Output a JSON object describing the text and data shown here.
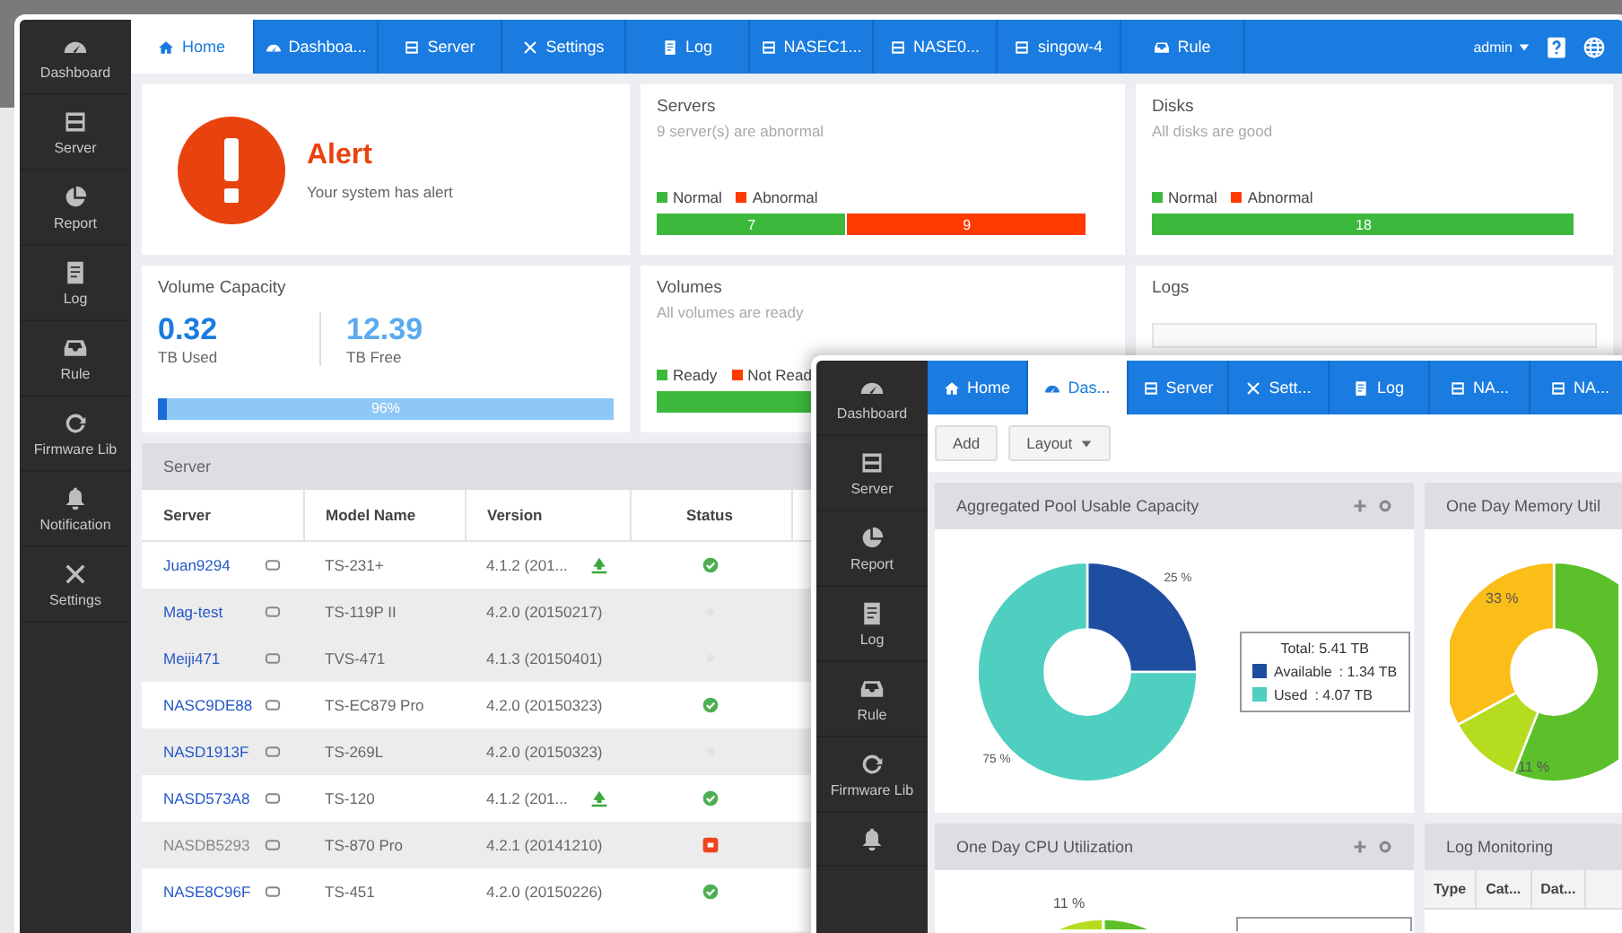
{
  "back_window": {
    "sidebar": [
      {
        "label": "Dashboard"
      },
      {
        "label": "Server"
      },
      {
        "label": "Report"
      },
      {
        "label": "Log"
      },
      {
        "label": "Rule"
      },
      {
        "label": "Firmware Lib"
      },
      {
        "label": "Notification"
      },
      {
        "label": "Settings"
      }
    ],
    "tabs": [
      {
        "label": "Home",
        "selected": true
      },
      {
        "label": "Dashboa...",
        "selected": false
      },
      {
        "label": "Server",
        "selected": false
      },
      {
        "label": "Settings",
        "selected": false
      },
      {
        "label": "Log",
        "selected": false
      },
      {
        "label": "NASEC1...",
        "selected": false
      },
      {
        "label": "NASE0...",
        "selected": false
      },
      {
        "label": "singow-4",
        "selected": false
      },
      {
        "label": "Rule",
        "selected": false
      }
    ],
    "user_menu": {
      "label": "admin"
    },
    "alert": {
      "title": "Alert",
      "message": "Your system has alert"
    },
    "servers": {
      "title": "Servers",
      "subtitle": "9 server(s) are abnormal",
      "legend": [
        {
          "label": "Normal",
          "color": "#3cb93c"
        },
        {
          "label": "Abnormal",
          "color": "#ff3b00"
        }
      ],
      "bar": [
        {
          "label": "7",
          "color": "#3cb93c",
          "level": 0.44
        },
        {
          "label": "9",
          "color": "#ff3b00",
          "level": 0.56
        }
      ]
    },
    "disks": {
      "title": "Disks",
      "subtitle": "All disks are good",
      "legend": [
        {
          "label": "Normal",
          "color": "#3cb93c"
        },
        {
          "label": "Abnormal",
          "color": "#ff3b00"
        }
      ],
      "bar": [
        {
          "label": "18",
          "color": "#3cb93c",
          "level": 1
        }
      ]
    },
    "volume_capacity": {
      "title": "Volume Capacity",
      "used": {
        "value": "0.32",
        "unit": "TB Used"
      },
      "free": {
        "value": "12.39",
        "unit": "TB Free"
      },
      "bar_label": "96%",
      "level": 0.02
    },
    "volumes": {
      "title": "Volumes",
      "subtitle": "All volumes are ready",
      "legend": [
        {
          "label": "Ready",
          "color": "#3cb93c"
        },
        {
          "label": "Not Read",
          "color": "#ff3b00"
        }
      ],
      "bar": [
        {
          "color": "#3cb93c",
          "level": 1
        }
      ]
    },
    "logs": {
      "title": "Logs"
    },
    "server_table": {
      "title": "Server",
      "columns": [
        "Server",
        "Model Name",
        "Version",
        "Status"
      ],
      "rows": [
        {
          "name": "Juan9294",
          "model": "TS-231+",
          "version": "4.1.2 (201...",
          "update": true,
          "kind": "ok",
          "offline": false,
          "disabled": false
        },
        {
          "name": "Mag-test",
          "model": "TS-119P II",
          "version": "4.2.0 (20150217)",
          "update": false,
          "kind": "none",
          "offline": true,
          "disabled": false
        },
        {
          "name": "Meiji471",
          "model": "TVS-471",
          "version": "4.1.3 (20150401)",
          "update": false,
          "kind": "none",
          "offline": true,
          "disabled": false
        },
        {
          "name": "NASC9DE88",
          "model": "TS-EC879 Pro",
          "version": "4.2.0 (20150323)",
          "update": false,
          "kind": "ok",
          "offline": false,
          "disabled": false
        },
        {
          "name": "NASD1913F",
          "model": "TS-269L",
          "version": "4.2.0 (20150323)",
          "update": false,
          "kind": "none",
          "offline": true,
          "disabled": false
        },
        {
          "name": "NASD573A8",
          "model": "TS-120",
          "version": "4.1.2 (201...",
          "update": true,
          "kind": "ok",
          "offline": false,
          "disabled": false
        },
        {
          "name": "NASDB5293",
          "model": "TS-870 Pro",
          "version": "4.2.1 (20141210)",
          "update": false,
          "kind": "error",
          "offline": true,
          "disabled": true
        },
        {
          "name": "NASE8C96F",
          "model": "TS-451",
          "version": "4.2.0 (20150226)",
          "update": false,
          "kind": "ok",
          "offline": false,
          "disabled": false
        }
      ]
    }
  },
  "front_window": {
    "sidebar": [
      {
        "label": "Dashboard"
      },
      {
        "label": "Server"
      },
      {
        "label": "Report"
      },
      {
        "label": "Log"
      },
      {
        "label": "Rule"
      },
      {
        "label": "Firmware Lib"
      }
    ],
    "tabs": [
      {
        "label": "Home",
        "selected": false
      },
      {
        "label": "Das...",
        "selected": true
      },
      {
        "label": "Server",
        "selected": false
      },
      {
        "label": "Sett...",
        "selected": false
      },
      {
        "label": "Log",
        "selected": false
      },
      {
        "label": "NA...",
        "selected": false
      },
      {
        "label": "NA...",
        "selected": false
      }
    ],
    "toolbar": [
      {
        "label": "Add",
        "dropdown": false
      },
      {
        "label": "Layout",
        "dropdown": true
      }
    ],
    "capacity_panel": {
      "title": "Aggregated Pool Usable Capacity",
      "chart_data": {
        "type": "donut",
        "categories": [
          "Available",
          "Used"
        ],
        "values": [
          25,
          75
        ],
        "value_labels": [
          "25 %",
          "75 %"
        ]
      },
      "legend": {
        "total": "Total: 5.41 TB",
        "items": [
          {
            "amount": ": 1.34 TB",
            "color": "#1f4ea1"
          },
          {
            "amount": ": 4.07 TB",
            "color": "#4ecfbf"
          }
        ]
      }
    },
    "memory_panel": {
      "title": "One Day Memory Util",
      "labels": [
        "33 %",
        "11 %"
      ]
    },
    "cpu_panel": {
      "title": "One Day CPU Utilization",
      "labels": [
        "11 %"
      ]
    },
    "log_panel": {
      "title": "Log Monitoring",
      "columns": [
        "Type",
        "Cat...",
        "Dat..."
      ]
    }
  }
}
